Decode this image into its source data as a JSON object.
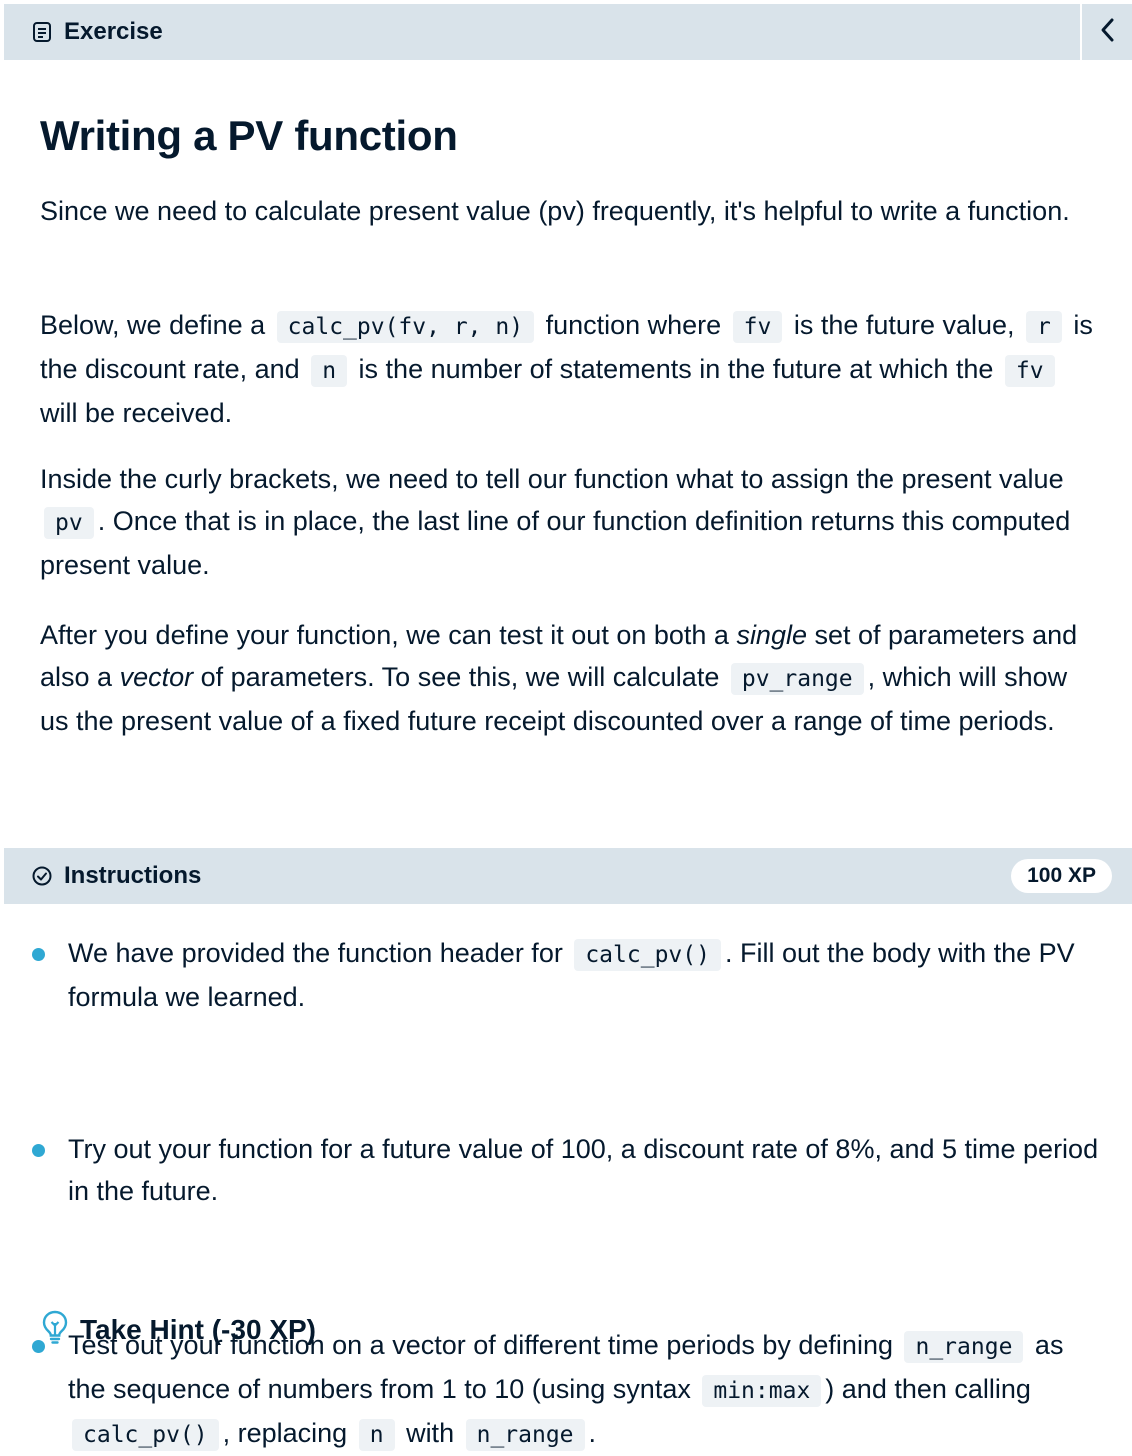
{
  "exercise_header": {
    "title": "Exercise",
    "icon": "document-icon",
    "collapse_icon": "chevron-left-icon"
  },
  "exercise": {
    "title": "Writing a PV function",
    "p1": "Since we need to calculate present value (pv) frequently, it's helpful to write a function.",
    "p2": {
      "t1": "Below, we define a ",
      "c1": "calc_pv(fv, r, n)",
      "t2": " function where ",
      "c2": "fv",
      "t3": " is the future value, ",
      "c3": "r",
      "t4": " is the discount rate, and ",
      "c4": "n",
      "t5": " is the number of statements in the future at which the ",
      "c5": "fv",
      "t6": " will be received."
    },
    "p3": {
      "t1": "Inside the curly brackets, we need to tell our function what to assign the present value ",
      "c1": "pv",
      "t2": ". Once that is in place, the last line of our function definition returns this computed present value."
    },
    "p4": {
      "t1": "After you define your function, we can test it out on both a ",
      "em1": "single",
      "t2": " set of parameters and also a ",
      "em2": "vector",
      "t3": " of parameters. To see this, we will calculate ",
      "c1": "pv_range",
      "t4": ", which will show us the present value of a fixed future receipt discounted over a range of time periods."
    }
  },
  "instructions_header": {
    "title": "Instructions",
    "icon": "check-circle-icon",
    "xp": "100 XP"
  },
  "instructions": {
    "item1": {
      "t1": "We have provided the function header for ",
      "c1": "calc_pv()",
      "t2": ". Fill out the body with the PV formula we learned."
    },
    "item2": {
      "t1": "Try out your function for a future value of 100, a discount rate of 8%, and 5 time period in the future."
    },
    "item3": {
      "t1": "Test out your function on a vector of different time periods by defining ",
      "c1": "n_range",
      "t2": " as the sequence of numbers from 1 to 10 (using syntax ",
      "c2": "min:max",
      "t3": ") and then calling ",
      "c3": "calc_pv()",
      "t4": ", replacing ",
      "c4": "n",
      "t5": " with ",
      "c5": "n_range",
      "t6": "."
    },
    "bullet_color": "#2fa8d3"
  },
  "hint": {
    "label": "Take Hint (-30 XP)",
    "icon": "lightbulb-icon",
    "icon_color": "#2fa8d3"
  }
}
